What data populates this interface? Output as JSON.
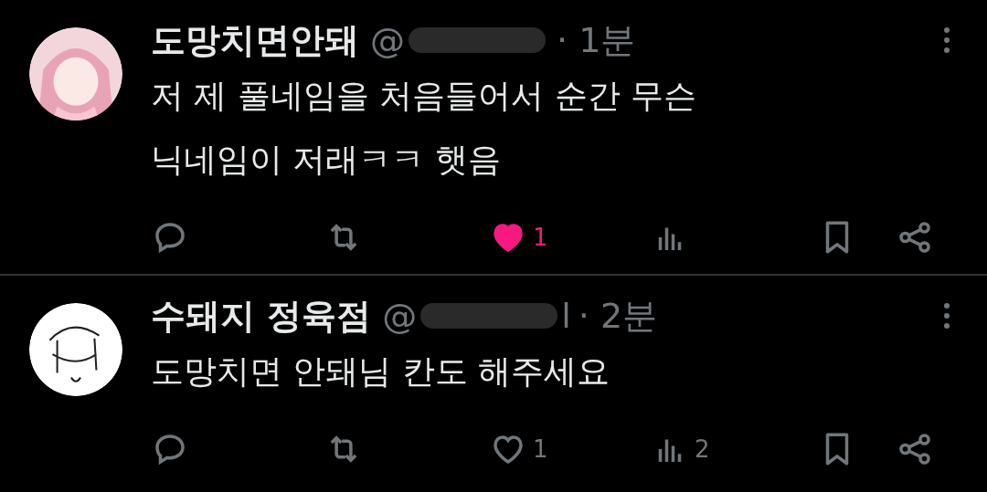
{
  "tweets": [
    {
      "avatar": {
        "kind": "pink"
      },
      "name": "도망치면안돼",
      "handle": "@",
      "time": "· 1분",
      "text": [
        "저 제 풀네임을 처음들어서 순간 무슨",
        "닉네임이 저래ㅋㅋ 햇음"
      ],
      "liked": true,
      "likes": "1"
    },
    {
      "avatar": {
        "kind": "sketch"
      },
      "name": "수돼지 정육점",
      "handle": "@",
      "handle_tail": "l",
      "time": "· 2분",
      "text": [
        "도망치면 안돼님 칸도 해주세요"
      ],
      "liked": false,
      "likes": "1",
      "views": "2"
    }
  ]
}
